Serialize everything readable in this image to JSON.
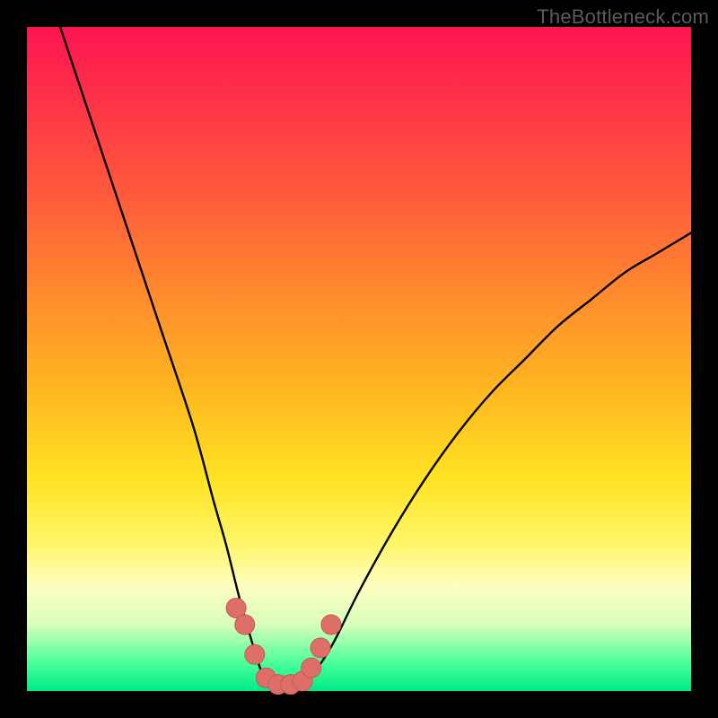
{
  "watermark": {
    "text": "TheBottleneck.com"
  },
  "colors": {
    "frame": "#000000",
    "curve": "#000000",
    "marker_fill": "#dd6e68",
    "marker_stroke": "#c55a55",
    "gradient_stops": [
      "#ff1450",
      "#ff2a4a",
      "#ff5a3c",
      "#ff8a2e",
      "#ffb820",
      "#ffe322",
      "#fff66a",
      "#fffdc0",
      "#d7ffba",
      "#46ff9a",
      "#00e887"
    ]
  },
  "chart_data": {
    "type": "line",
    "title": "",
    "xlabel": "",
    "ylabel": "",
    "xlim": [
      0,
      100
    ],
    "ylim": [
      0,
      100
    ],
    "grid": false,
    "legend": false,
    "x": [
      5,
      10,
      15,
      20,
      25,
      28,
      30,
      32,
      34,
      35.5,
      37,
      39,
      41,
      43,
      46,
      50,
      55,
      60,
      65,
      70,
      75,
      80,
      85,
      90,
      95,
      100
    ],
    "series": [
      {
        "name": "bottleneck-curve",
        "values": [
          100,
          85,
          70,
          55,
          40,
          29,
          22,
          14,
          7,
          2.5,
          0.8,
          0.5,
          0.8,
          2.5,
          7,
          15,
          24,
          32,
          39,
          45,
          50,
          55,
          59,
          63,
          66,
          69
        ]
      }
    ],
    "markers": {
      "name": "highlighted-points",
      "x": [
        31.5,
        32.8,
        34.3,
        36.0,
        37.8,
        39.7,
        41.5,
        42.8,
        44.2,
        45.8
      ],
      "values": [
        12.5,
        10.0,
        5.5,
        2.0,
        1.0,
        1.0,
        1.5,
        3.5,
        6.5,
        10.0
      ]
    }
  }
}
